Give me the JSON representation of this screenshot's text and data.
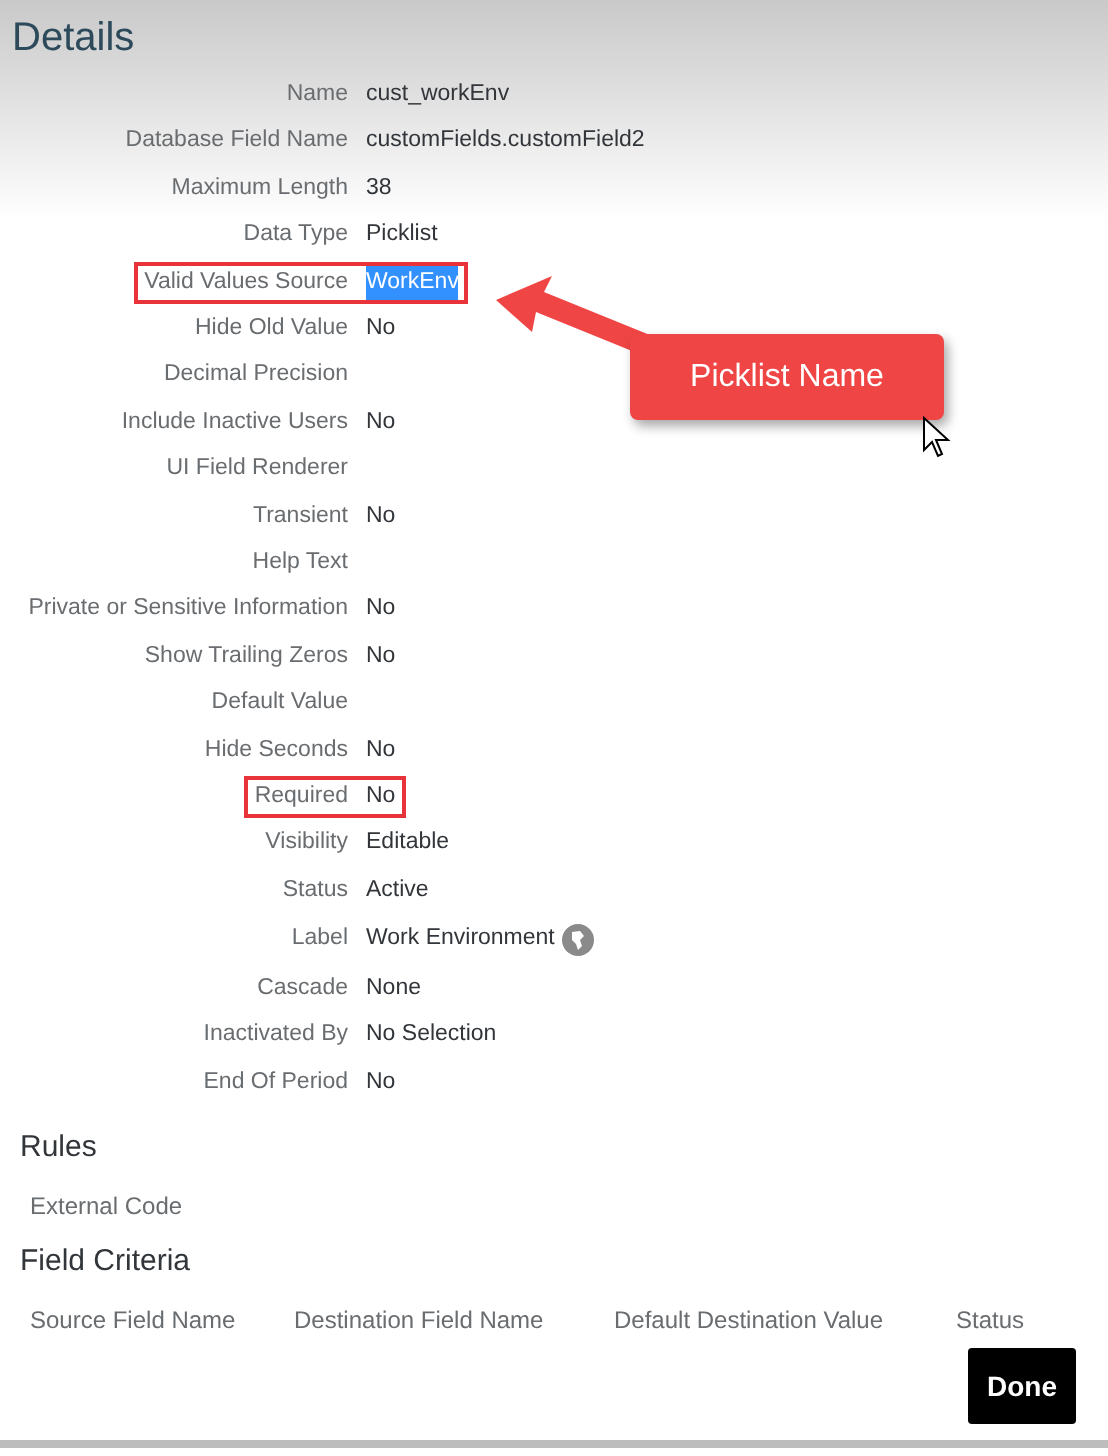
{
  "title": "Details",
  "fields": [
    {
      "label": "Name",
      "value": "cust_workEnv",
      "kind": "text",
      "highlighted": false,
      "selected": false
    },
    {
      "label": "Database Field Name",
      "value": "customFields.customField2",
      "kind": "text",
      "highlighted": false,
      "selected": false
    },
    {
      "label": "Maximum Length",
      "value": "38",
      "kind": "text",
      "highlighted": false,
      "selected": false
    },
    {
      "label": "Data Type",
      "value": "Picklist",
      "kind": "text",
      "highlighted": false,
      "selected": false
    },
    {
      "label": "Valid Values Source",
      "value": "WorkEnv",
      "kind": "text",
      "highlighted": true,
      "selected": true
    },
    {
      "label": "Hide Old Value",
      "value": "No",
      "kind": "text",
      "highlighted": false,
      "selected": false
    },
    {
      "label": "Decimal Precision",
      "kind": "text",
      "highlighted": false,
      "selected": false
    },
    {
      "label": "Include Inactive Users",
      "value": "No",
      "kind": "text",
      "highlighted": false,
      "selected": false
    },
    {
      "label": "UI Field Renderer",
      "kind": "text",
      "highlighted": false,
      "selected": false
    },
    {
      "label": "Transient",
      "value": "No",
      "kind": "text",
      "highlighted": false,
      "selected": false
    },
    {
      "label": "Help Text",
      "kind": "text",
      "highlighted": false,
      "selected": false
    },
    {
      "label": "Private or Sensitive Information",
      "value": "No",
      "kind": "text",
      "highlighted": false,
      "selected": false
    },
    {
      "label": "Show Trailing Zeros",
      "value": "No",
      "kind": "text",
      "highlighted": false,
      "selected": false
    },
    {
      "label": "Default Value",
      "kind": "text",
      "highlighted": false,
      "selected": false
    },
    {
      "label": "Hide Seconds",
      "value": "No",
      "kind": "text",
      "highlighted": false,
      "selected": false
    },
    {
      "label": "Required",
      "value": "No",
      "kind": "text",
      "highlighted": true,
      "selected": false
    },
    {
      "label": "Visibility",
      "value": "Editable",
      "kind": "text",
      "highlighted": false,
      "selected": false
    },
    {
      "label": "Status",
      "value": "Active",
      "kind": "text",
      "highlighted": false,
      "selected": false
    },
    {
      "label": "Label",
      "value": "Work Environment",
      "kind": "translatable",
      "highlighted": false,
      "selected": false
    },
    {
      "label": "Cascade",
      "value": "None",
      "kind": "text",
      "highlighted": false,
      "selected": false
    },
    {
      "label": "Inactivated By",
      "value": "No Selection",
      "kind": "text",
      "highlighted": false,
      "selected": false
    },
    {
      "label": "End Of Period",
      "value": "No",
      "kind": "text",
      "highlighted": false,
      "selected": false
    }
  ],
  "callout": {
    "text": "Picklist Name"
  },
  "rules": {
    "title": "Rules",
    "columns": [
      "External Code"
    ]
  },
  "field_criteria": {
    "title": "Field Criteria",
    "columns": [
      "Source Field Name",
      "Destination Field Name",
      "Default Destination Value",
      "Status"
    ]
  },
  "done_button": "Done"
}
